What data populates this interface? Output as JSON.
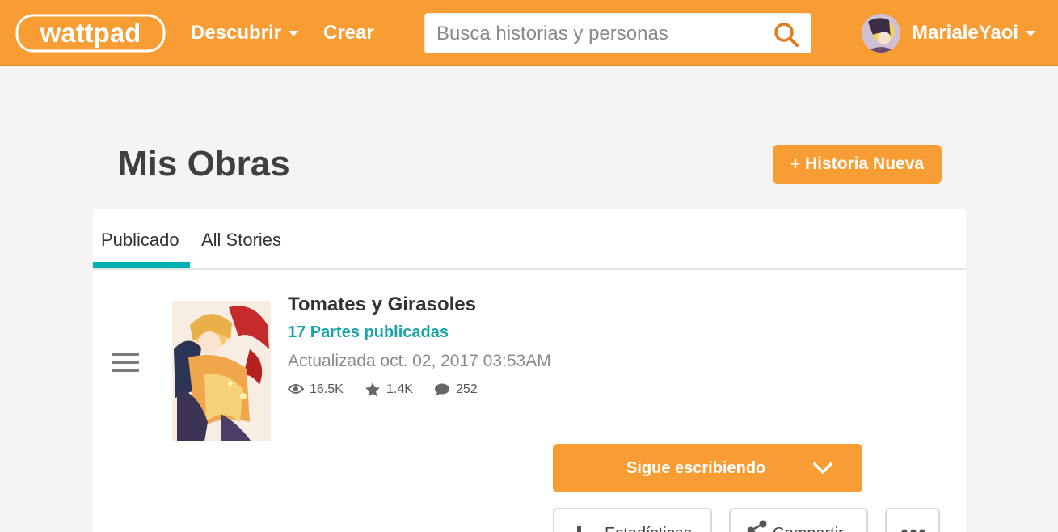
{
  "header": {
    "logo_text": "wattpad",
    "nav_discover": "Descubrir",
    "nav_create": "Crear",
    "search_placeholder": "Busca historias y personas",
    "username": "MarialeYaoi"
  },
  "page": {
    "title": "Mis Obras",
    "new_story_button": "+ Historia Nueva"
  },
  "tabs": [
    {
      "label": "Publicado",
      "active": true
    },
    {
      "label": "All Stories",
      "active": false
    }
  ],
  "story": {
    "title": "Tomates y Girasoles",
    "parts": "17 Partes publicadas",
    "updated": "Actualizada oct. 02, 2017 03:53AM",
    "reads": "16.5K",
    "votes": "1.4K",
    "comments": "252",
    "continue_button": "Sigue escribiendo",
    "stats_button": "Estadísticas",
    "share_button": "Compartir"
  },
  "colors": {
    "brand_orange": "#f89d33",
    "accent_teal": "#00b2b2"
  },
  "icons": [
    "logo-icon",
    "chevron-down-icon",
    "search-icon",
    "avatar",
    "hamburger-icon",
    "eye-icon",
    "star-icon",
    "comment-icon",
    "bar-chart-icon",
    "share-icon",
    "ellipsis-icon"
  ]
}
